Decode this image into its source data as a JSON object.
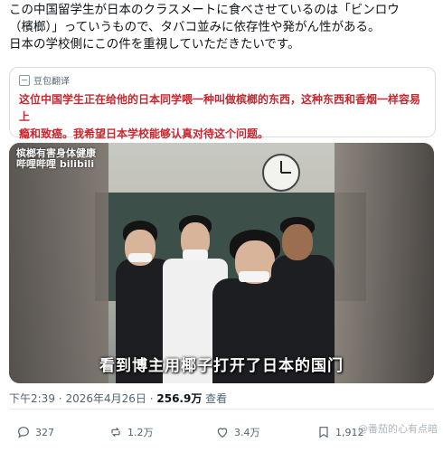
{
  "post": {
    "lines": [
      "この中国留学生が日本のクラスメートに食べさせているのは「ビンロウ",
      "（檳榔）」っていうもので、タバコ並みに依存性や発がん性がある。",
      "日本の学校側にこの件を重視していただきたいです。"
    ]
  },
  "translation": {
    "label": "豆包翻译",
    "text_line1": "这位中国学生正在给他的日本同学喂一种叫做槟榔的东西，这种东西和香烟一样容易上",
    "text_line2": "瘾和致癌。我希望日本学校能够认真对待这个问题。"
  },
  "media": {
    "watermark_line1": "槟榔有害身体健康",
    "watermark_line2": "哔哩哔哩 bilibili",
    "subtitle": "看到博主用椰子打开了日本的国门"
  },
  "meta": {
    "time": "下午2:39",
    "sep1": "·",
    "date": "2026年4月26日",
    "sep2": "·",
    "views": "256.9万",
    "views_label": "查看"
  },
  "actions": {
    "replies": "327",
    "reposts": "1.2万",
    "likes": "3.4万",
    "bookmarks": "1,912"
  },
  "overlay_watermark": "@番茄的心有点暗",
  "icons": [
    "reply-icon",
    "repost-icon",
    "like-icon",
    "bookmark-icon",
    "translate-icon"
  ]
}
